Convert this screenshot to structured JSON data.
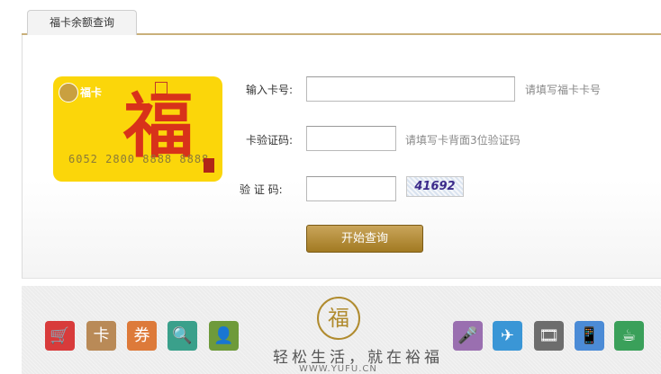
{
  "tab": {
    "label": "福卡余额查询"
  },
  "card": {
    "brand": "福卡",
    "character": "福",
    "number": "6052 2800 8888 8888",
    "seal": "福卡"
  },
  "form": {
    "card_no_label": "输入卡号:",
    "card_no_hint": "请填写福卡卡号",
    "card_no_value": "",
    "verify_code_label": "卡验证码:",
    "verify_code_hint": "请填写卡背面3位验证码",
    "verify_code_value": "",
    "captcha_label": "验 证 码:",
    "captcha_value": "",
    "captcha_image_text": "41692",
    "submit_label": "开始查询"
  },
  "footer": {
    "emblem": "福",
    "slogan": "轻松生活，就在裕福",
    "url": "WWW.YUFU.CN",
    "left_icons": [
      {
        "name": "cart-icon",
        "color": "#d83b3b",
        "glyph": "🛒"
      },
      {
        "name": "gift-card-icon",
        "color": "#b98a57",
        "glyph": "卡"
      },
      {
        "name": "ticket-icon",
        "color": "#dd7a3a",
        "glyph": "券"
      },
      {
        "name": "search-doc-icon",
        "color": "#3aa08b",
        "glyph": "🔍"
      },
      {
        "name": "contact-card-icon",
        "color": "#6e9a3a",
        "glyph": "👤"
      }
    ],
    "right_icons": [
      {
        "name": "microphone-icon",
        "color": "#9a6fb0",
        "glyph": "🎤"
      },
      {
        "name": "airplane-icon",
        "color": "#3a96d6",
        "glyph": "✈"
      },
      {
        "name": "film-icon",
        "color": "#6d6d6d",
        "glyph": "🎞"
      },
      {
        "name": "mobile-phone-icon",
        "color": "#4b8bd6",
        "glyph": "📱"
      },
      {
        "name": "coffee-cup-icon",
        "color": "#3aa05a",
        "glyph": "☕"
      }
    ]
  }
}
